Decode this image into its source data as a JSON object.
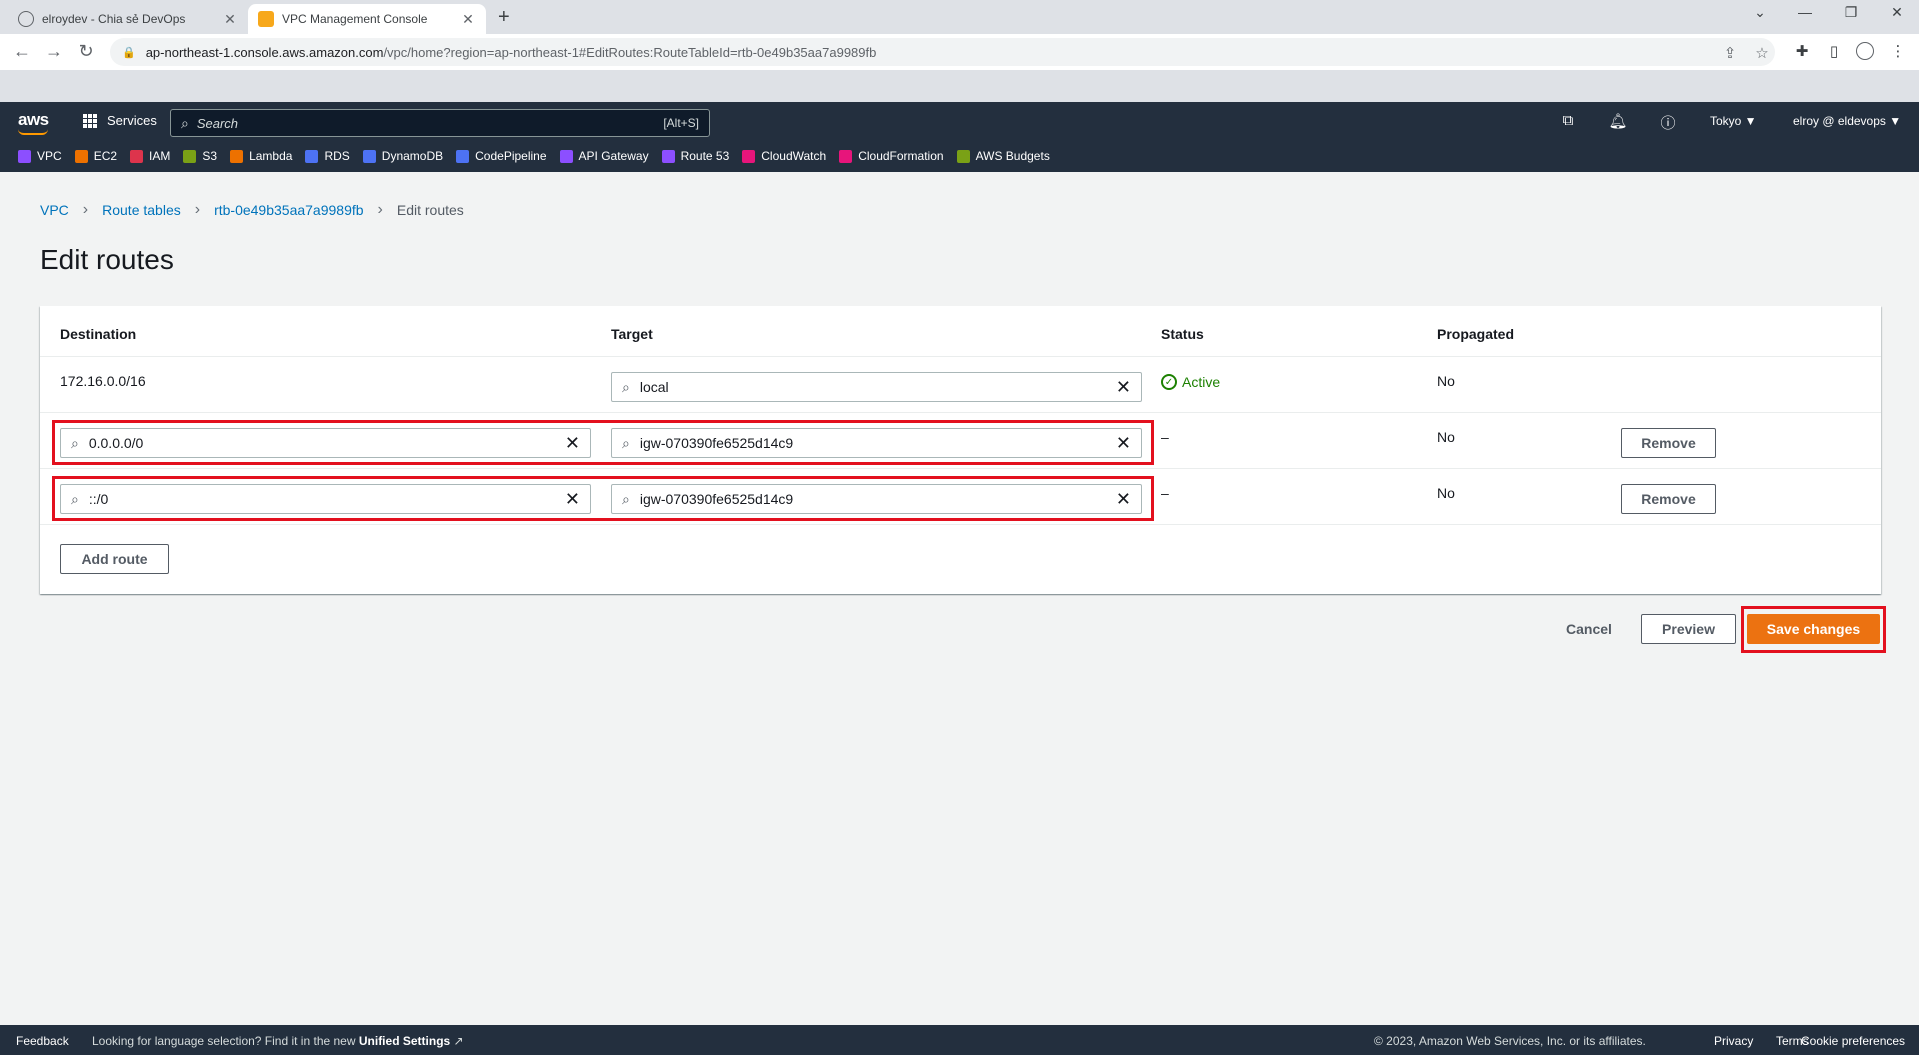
{
  "browser": {
    "tabs": [
      {
        "title": "elroydev - Chia sẻ DevOps"
      },
      {
        "title": "VPC Management Console"
      }
    ],
    "url_host": "ap-northeast-1.console.aws.amazon.com",
    "url_path": "/vpc/home?region=ap-northeast-1#EditRoutes:RouteTableId=rtb-0e49b35aa7a9989fb"
  },
  "aws_header": {
    "logo": "aws",
    "services_label": "Services",
    "search_placeholder": "Search",
    "search_shortcut": "[Alt+S]",
    "region": "Tokyo ▼",
    "account": "elroy @ eldevops ▼",
    "favorites": [
      {
        "label": "VPC",
        "color": "#8c4fff"
      },
      {
        "label": "EC2",
        "color": "#ed7100"
      },
      {
        "label": "IAM",
        "color": "#dd344c"
      },
      {
        "label": "S3",
        "color": "#7aa116"
      },
      {
        "label": "Lambda",
        "color": "#ed7100"
      },
      {
        "label": "RDS",
        "color": "#4d72f3"
      },
      {
        "label": "DynamoDB",
        "color": "#4d72f3"
      },
      {
        "label": "CodePipeline",
        "color": "#4d72f3"
      },
      {
        "label": "API Gateway",
        "color": "#8c4fff"
      },
      {
        "label": "Route 53",
        "color": "#8c4fff"
      },
      {
        "label": "CloudWatch",
        "color": "#e7157b"
      },
      {
        "label": "CloudFormation",
        "color": "#e7157b"
      },
      {
        "label": "AWS Budgets",
        "color": "#7aa116"
      }
    ]
  },
  "breadcrumb": {
    "vpc": "VPC",
    "route_tables": "Route tables",
    "rtb": "rtb-0e49b35aa7a9989fb",
    "current": "Edit routes"
  },
  "page_title": "Edit routes",
  "table": {
    "headers": {
      "destination": "Destination",
      "target": "Target",
      "status": "Status",
      "propagated": "Propagated"
    },
    "rows": [
      {
        "destination": "172.16.0.0/16",
        "target": "local",
        "status": "Active",
        "propagated": "No"
      },
      {
        "destination": "0.0.0.0/0",
        "target": "igw-070390fe6525d14c9",
        "status": "–",
        "propagated": "No",
        "remove": "Remove"
      },
      {
        "destination": "::/0",
        "target": "igw-070390fe6525d14c9",
        "status": "–",
        "propagated": "No",
        "remove": "Remove"
      }
    ],
    "add_route": "Add route"
  },
  "actions": {
    "cancel": "Cancel",
    "preview": "Preview",
    "save": "Save changes"
  },
  "footer": {
    "feedback": "Feedback",
    "language_note": "Looking for language selection? Find it in the new",
    "unified_settings": "Unified Settings",
    "copyright": "© 2023, Amazon Web Services, Inc. or its affiliates.",
    "privacy": "Privacy",
    "terms": "Terms",
    "cookie": "Cookie preferences"
  },
  "colors": {
    "primary_button": "#ec7211",
    "link": "#0073bb",
    "highlight": "#e3101e",
    "header_bg": "#232f3e",
    "status_active": "#1d8102"
  }
}
